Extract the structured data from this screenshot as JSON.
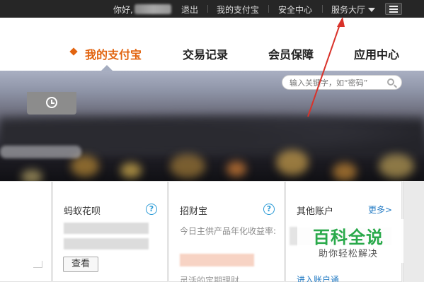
{
  "topbar": {
    "greeting": "你好,",
    "logout": "退出",
    "my_alipay": "我的支付宝",
    "security": "安全中心",
    "service_hall": "服务大厅",
    "menu_icon": "list-icon"
  },
  "nav": {
    "tabs": [
      {
        "label": "我的支付宝",
        "active": true
      },
      {
        "label": "交易记录",
        "active": false
      },
      {
        "label": "会员保障",
        "active": false
      },
      {
        "label": "应用中心",
        "active": false
      }
    ],
    "accent_color": "#e26410"
  },
  "search": {
    "placeholder": "输入关键字，如“密码”",
    "icon": "search-icon"
  },
  "banner": {
    "alarm_icon": "alarm-clock-icon"
  },
  "cards": {
    "huabei": {
      "title": "蚂蚁花呗",
      "help": "?",
      "button": "查看"
    },
    "zhaocaibao": {
      "title": "招财宝",
      "help": "?",
      "desc": "今日主供产品年化收益率:",
      "bottom_text": "灵活的定期理财"
    },
    "other": {
      "title": "其他账户",
      "more": "更多>",
      "link": "进入账户通"
    }
  },
  "watermark": {
    "big": "百科全说",
    "small": "助你轻松解决",
    "color": "#29a94a"
  },
  "annotation_color": "#d9322a"
}
